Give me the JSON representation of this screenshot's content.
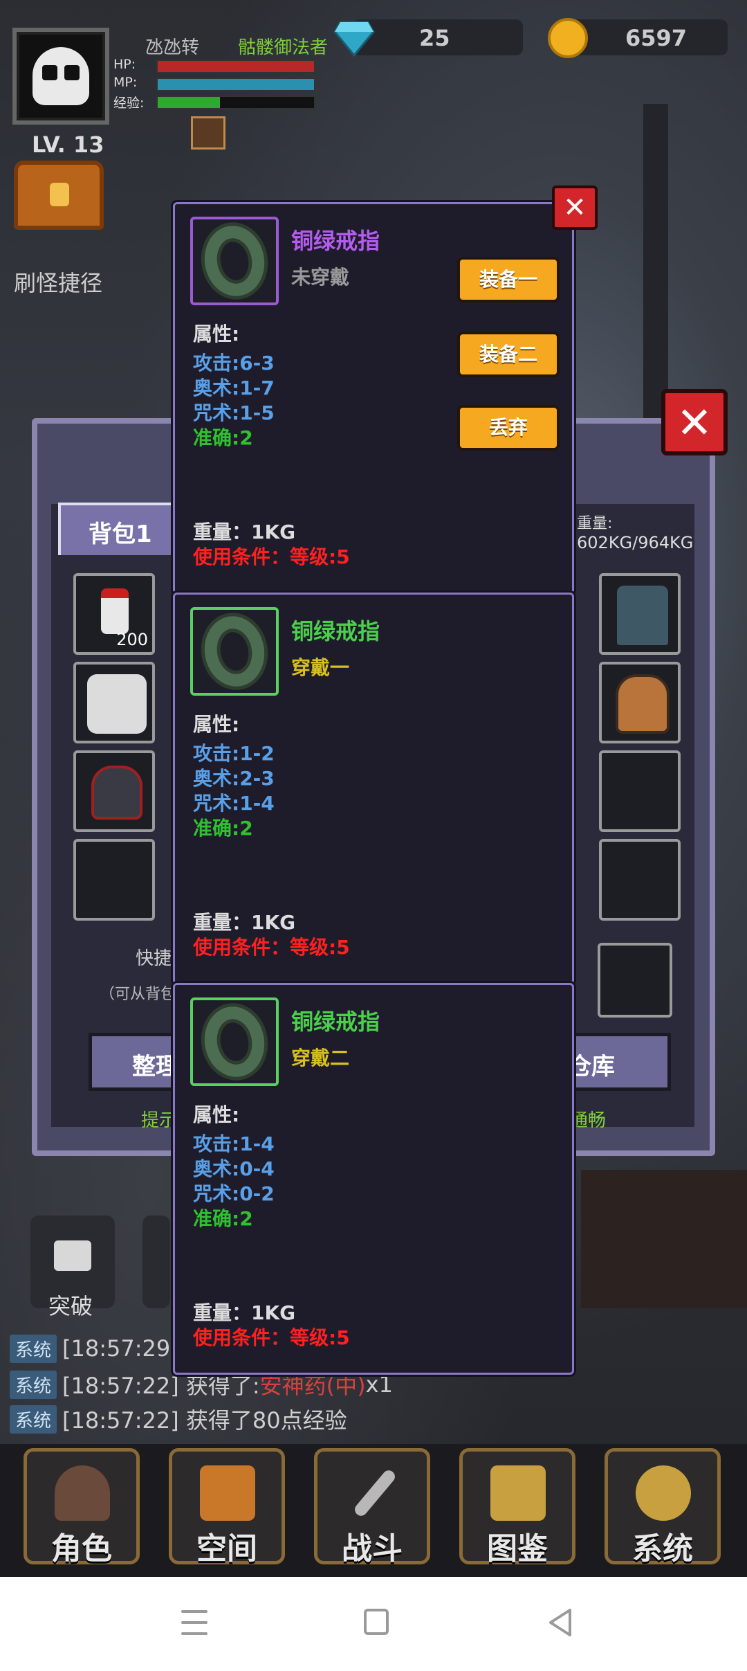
{
  "player": {
    "name": "氹氹转",
    "class": "骷髅御法者",
    "level": "LV. 13",
    "hp_label": "HP:",
    "mp_label": "MP:",
    "exp_label": "经验:",
    "hp": 1.0,
    "mp": 1.0,
    "exp": 0.4
  },
  "currency": {
    "gems": "25",
    "gold": "6597"
  },
  "left_menu": {
    "shortcut": "刷怪捷径",
    "breakthrough": "突破"
  },
  "backpack": {
    "tab": "背包1",
    "weight_label": "重量:",
    "weight_value": "602KG/964KG",
    "potion_qty": "200",
    "quick_label": "快捷",
    "quick_hint": "（可从背包",
    "sort_button": "整理",
    "warehouse_button": "仓库",
    "hint_left": "提示",
    "hint_right": "通畅"
  },
  "cards": [
    {
      "name": "铜绿戒指",
      "name_color": "#b45cf0",
      "frame_color": "#9a5cd0",
      "state": "未穿戴",
      "state_color": "#9a9a9a",
      "attr_title": "属性:",
      "attrs": [
        "攻击:6-3",
        "奥术:1-7",
        "咒术:1-5",
        "准确:2"
      ],
      "weight": "重量：1KG",
      "requirement": "使用条件：等级:5",
      "buttons": [
        "装备一",
        "装备二",
        "丢弃"
      ]
    },
    {
      "name": "铜绿戒指",
      "name_color": "#4ad04a",
      "frame_color": "#5ad060",
      "state": "穿戴一",
      "state_color": "#d8c020",
      "attr_title": "属性:",
      "attrs": [
        "攻击:1-2",
        "奥术:2-3",
        "咒术:1-4",
        "准确:2"
      ],
      "weight": "重量：1KG",
      "requirement": "使用条件：等级:5"
    },
    {
      "name": "铜绿戒指",
      "name_color": "#4ad04a",
      "frame_color": "#5ad060",
      "state": "穿戴二",
      "state_color": "#d8c020",
      "attr_title": "属性:",
      "attrs": [
        "攻击:1-4",
        "奥术:0-4",
        "咒术:0-2",
        "准确:2"
      ],
      "weight": "重量：1KG",
      "requirement": "使用条件：等级:5"
    }
  ],
  "chat": [
    {
      "tag": "系统",
      "text": "[18:57:29"
    },
    {
      "tag": "系统",
      "text": "[18:57:22] 获得了:",
      "item": "安神药(中)",
      "suffix": " x1"
    },
    {
      "tag": "系统",
      "text": "[18:57:22] 获得了80点经验"
    }
  ],
  "nav": [
    "角色",
    "空间",
    "战斗",
    "图鉴",
    "系统"
  ],
  "icons": {
    "close": "✕",
    "gem": "blue-diamond-icon",
    "coin": "gold-coin-icon"
  },
  "colors": {
    "accent_orange": "#f5a820",
    "close_red": "#d3262b"
  }
}
